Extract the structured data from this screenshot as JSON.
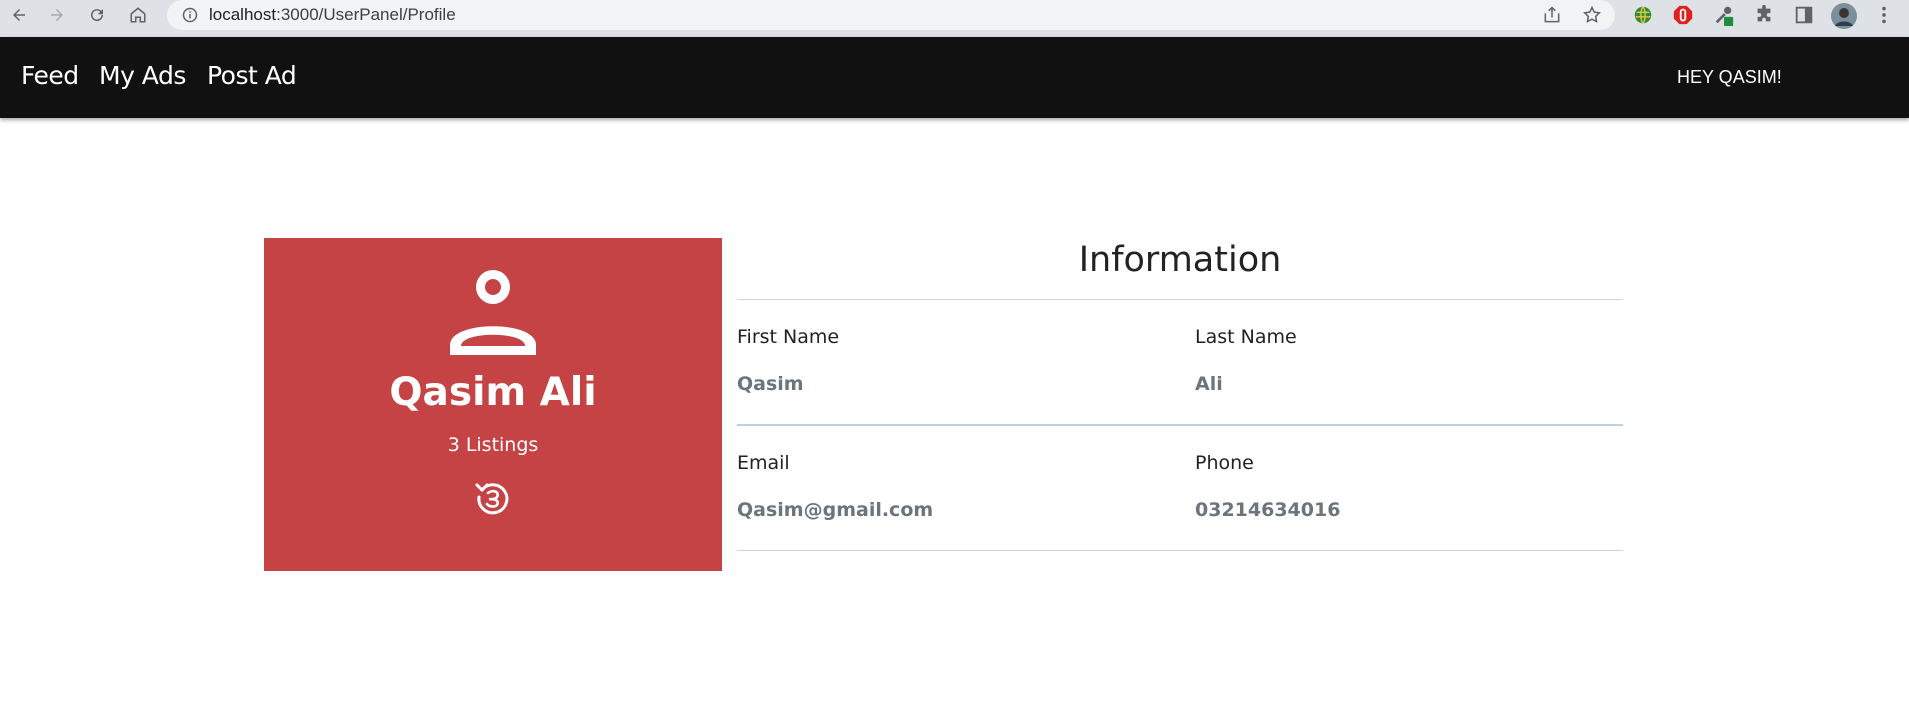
{
  "browser": {
    "url_host": "localhost",
    "url_path": ":3000/UserPanel/Profile",
    "icons": [
      "back-icon",
      "forward-icon",
      "reload-icon",
      "home-icon",
      "site-info-icon",
      "share-icon",
      "bookmark-star-icon",
      "extension-globe-icon",
      "extension-adblock-icon",
      "extension-eyedropper-icon",
      "extensions-puzzle-icon",
      "side-panel-icon",
      "profile-avatar-icon",
      "menu-kebab-icon"
    ]
  },
  "navbar": {
    "links": [
      "Feed",
      "My Ads",
      "Post Ad"
    ],
    "greeting": "HEY QASIM!"
  },
  "profile": {
    "name": "Qasim Ali",
    "listings": "3 Listings"
  },
  "information": {
    "title": "Information",
    "first_name_label": "First Name",
    "first_name_value": "Qasim",
    "last_name_label": "Last Name",
    "last_name_value": "Ali",
    "email_label": "Email",
    "email_value": "Qasim@gmail.com",
    "phone_label": "Phone",
    "phone_value": "03214634016"
  },
  "colors": {
    "card_bg": "#c64345",
    "navbar_bg": "#111111",
    "value_text": "#6c757d"
  }
}
